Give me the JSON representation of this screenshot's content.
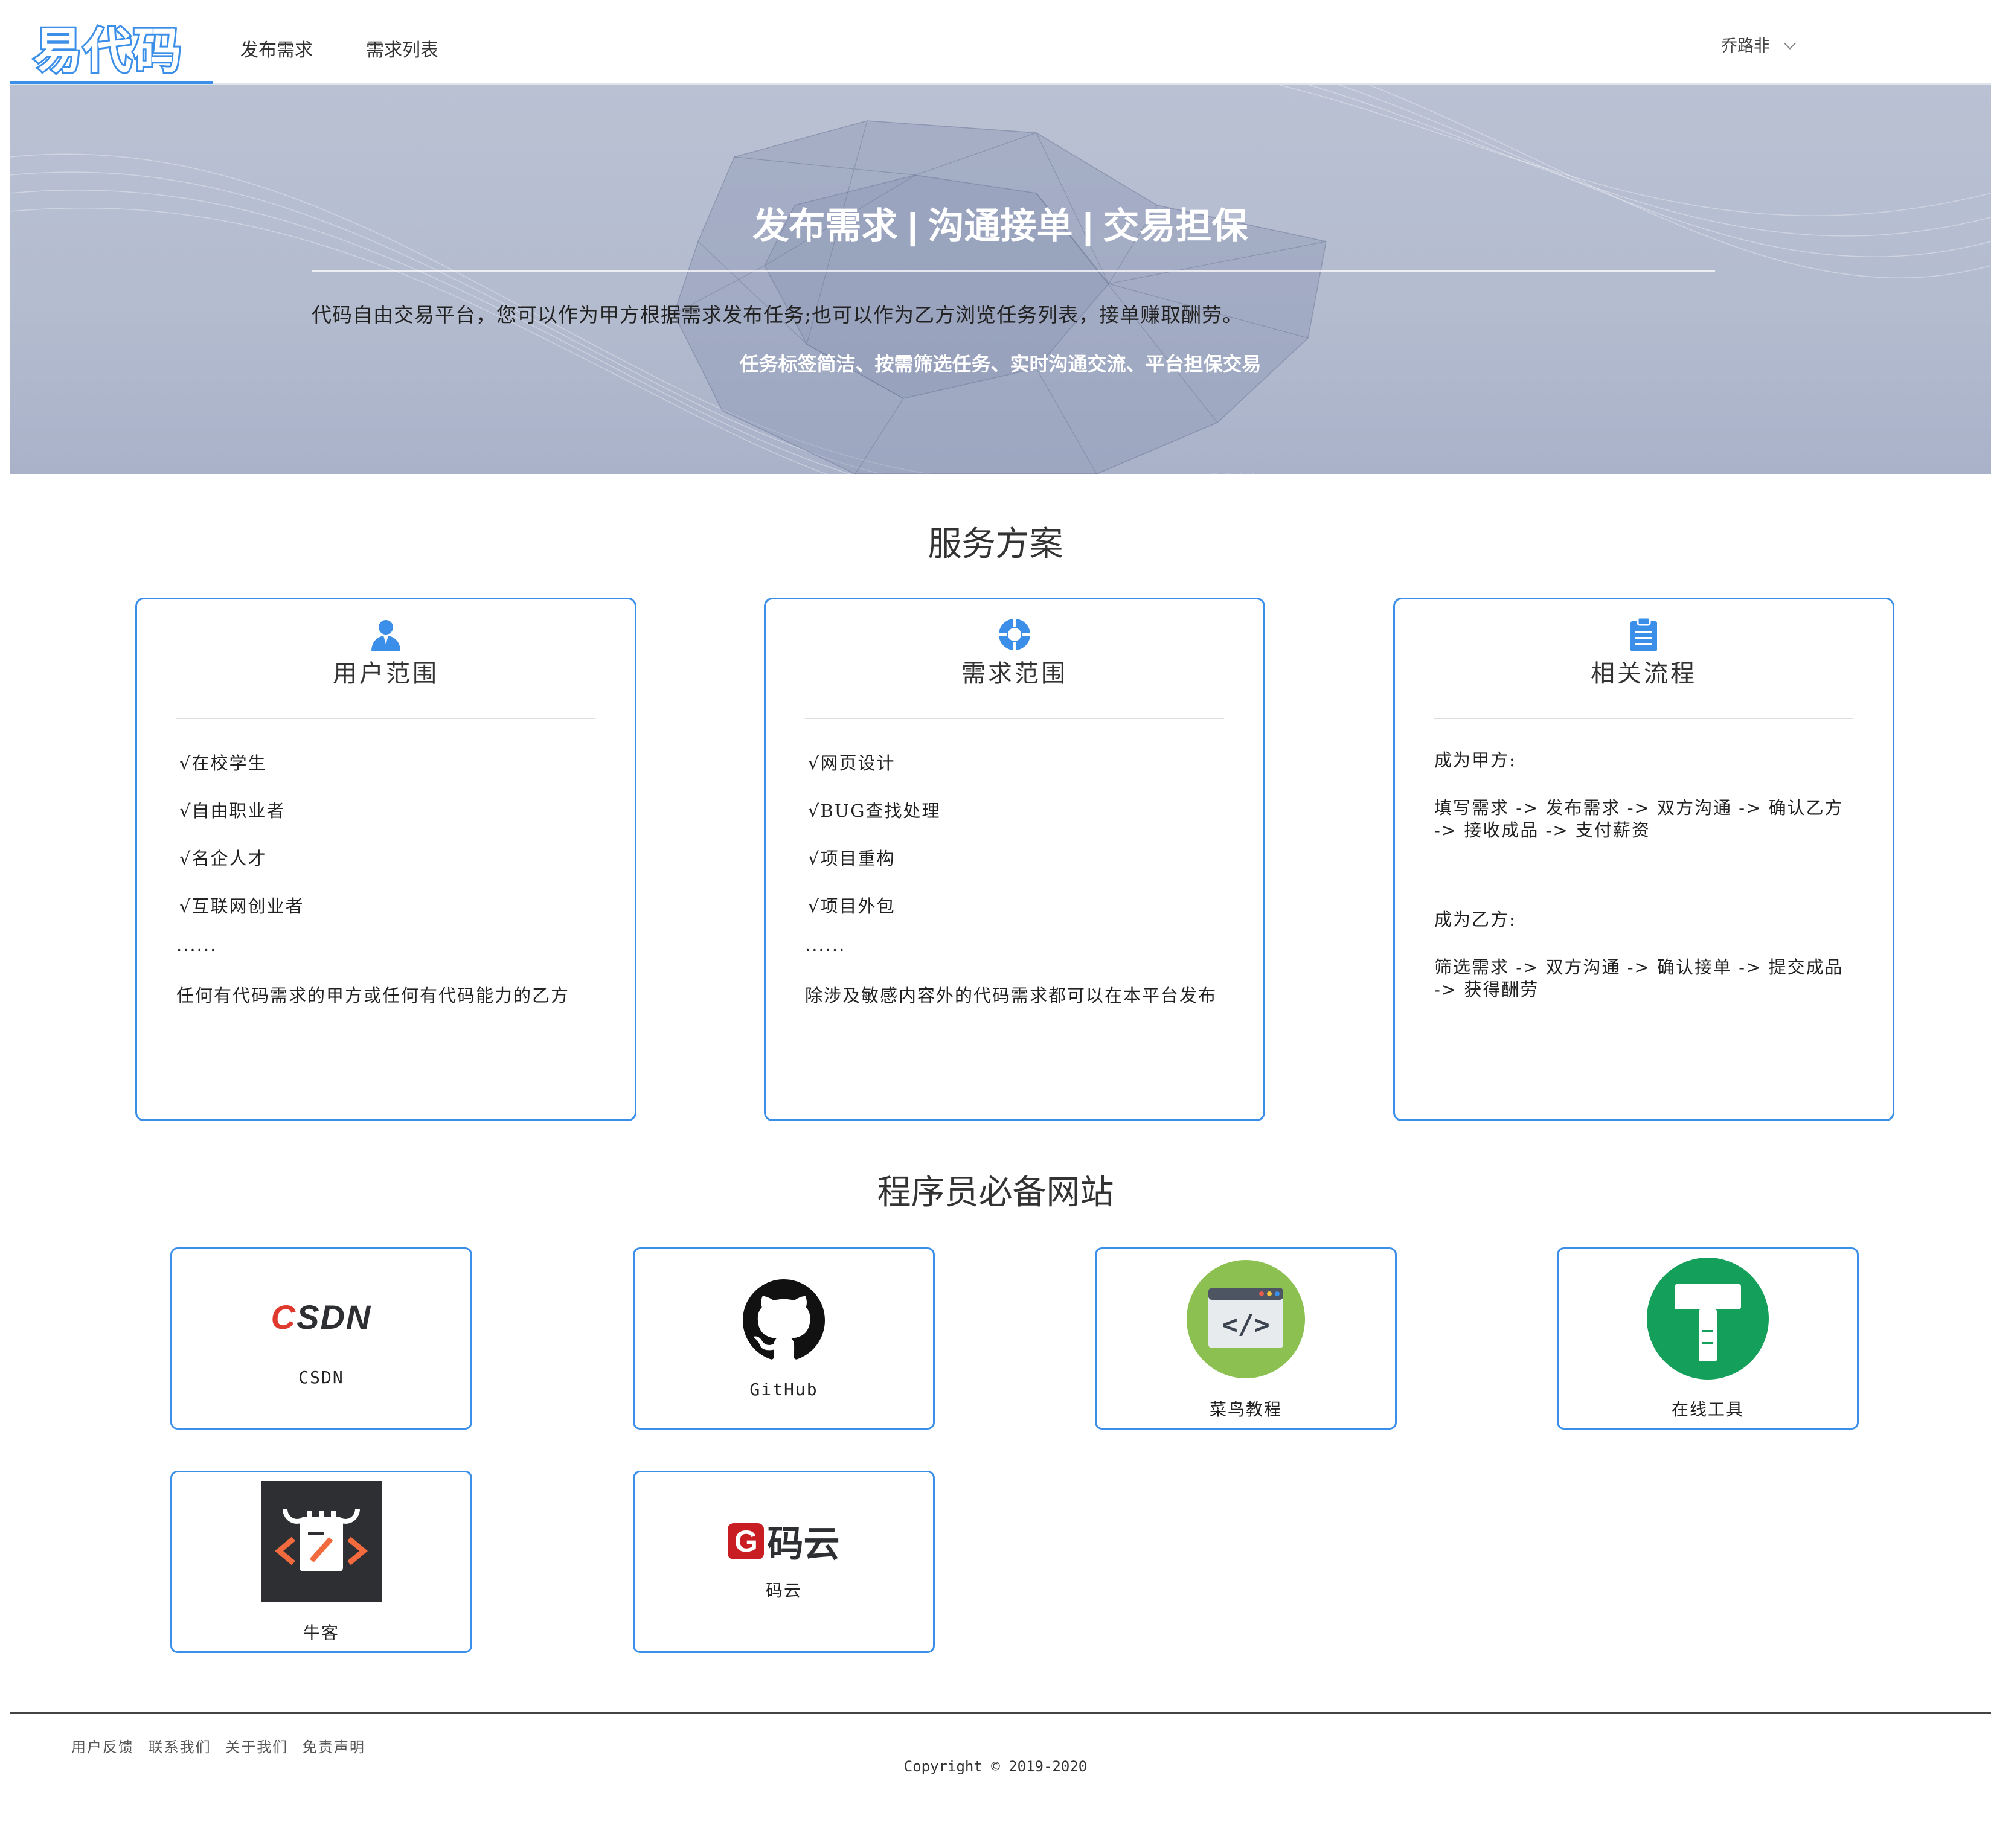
{
  "header": {
    "logo": "易代码",
    "nav": [
      "发布需求",
      "需求列表"
    ],
    "user": "乔路非"
  },
  "banner": {
    "title": "发布需求 | 沟通接单 | 交易担保",
    "description": "代码自由交易平台，您可以作为甲方根据需求发布任务;也可以作为乙方浏览任务列表，接单赚取酬劳。",
    "subtitle": "任务标签简洁、按需筛选任务、实时沟通交流、平台担保交易"
  },
  "services": {
    "title": "服务方案",
    "cards": [
      {
        "icon": "user-icon",
        "title": "用户范围",
        "items": [
          "√在校学生",
          "√自由职业者",
          "√名企人才",
          "√互联网创业者"
        ],
        "ellipsis": "......",
        "note": "任何有代码需求的甲方或任何有代码能力的乙方"
      },
      {
        "icon": "target-icon",
        "title": "需求范围",
        "items": [
          "√网页设计",
          "√BUG查找处理",
          "√项目重构",
          "√项目外包"
        ],
        "ellipsis": "......",
        "note": "除涉及敏感内容外的代码需求都可以在本平台发布"
      },
      {
        "icon": "clipboard-icon",
        "title": "相关流程",
        "party_a_label": "成为甲方:",
        "party_a_flow": "填写需求 -> 发布需求 -> 双方沟通 -> 确认乙方 -> 接收成品 -> 支付薪资",
        "party_b_label": "成为乙方:",
        "party_b_flow": "筛选需求 -> 双方沟通 -> 确认接单 -> 提交成品 -> 获得酬劳"
      }
    ]
  },
  "sites": {
    "title": "程序员必备网站",
    "items": [
      {
        "name": "CSDN",
        "logo_text": "CSDN"
      },
      {
        "name": "GitHub"
      },
      {
        "name": "菜鸟教程"
      },
      {
        "name": "在线工具"
      },
      {
        "name": "牛客"
      },
      {
        "name": "码云",
        "logo_text": "码云"
      }
    ]
  },
  "footer": {
    "links": [
      "用户反馈",
      "联系我们",
      "关于我们",
      "免责声明"
    ],
    "copyright": "Copyright © 2019-2020"
  },
  "colors": {
    "accent": "#3b8fe8",
    "banner": "#b3bbcf",
    "csdn_red": "#e03a2f",
    "gitee_red": "#c71d23",
    "runoob_green": "#8cc152",
    "tool_green": "#14a05a",
    "nowcoder_dark": "#2d2f33",
    "nowcoder_orange": "#f26a3e"
  }
}
